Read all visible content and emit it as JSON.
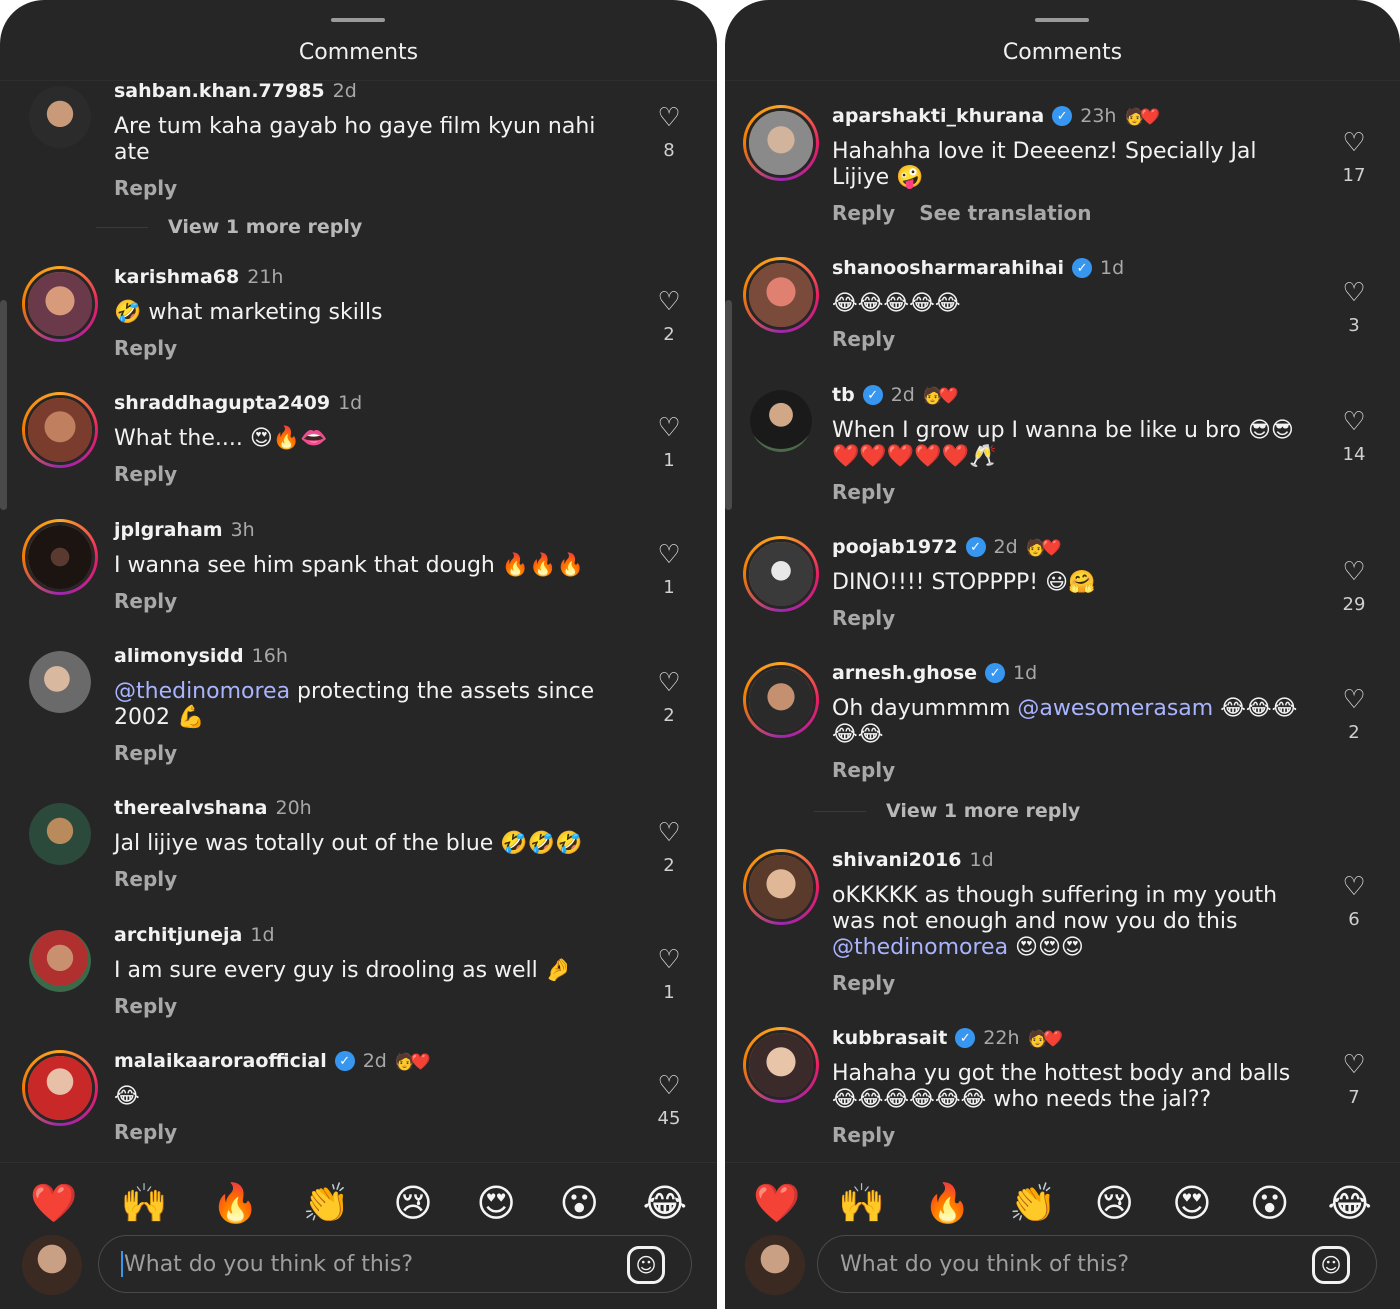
{
  "left": {
    "header_title": "Comments",
    "comments": [
      {
        "username": "sahban.khan.77985",
        "time": "2d",
        "verified": false,
        "creator_liked": false,
        "text_parts": [
          {
            "t": "Are tum kaha gayab ho gaye film kyun nahi ate",
            "m": false
          }
        ],
        "actions": [
          "Reply"
        ],
        "likes": "8",
        "more_replies": "View 1 more reply"
      },
      {
        "username": "karishma68",
        "time": "21h",
        "verified": false,
        "creator_liked": false,
        "text_parts": [
          {
            "t": "🤣 what marketing skills",
            "m": false
          }
        ],
        "actions": [
          "Reply"
        ],
        "likes": "2"
      },
      {
        "username": "shraddhagupta2409",
        "time": "1d",
        "verified": false,
        "creator_liked": false,
        "text_parts": [
          {
            "t": "What the.... 😍🔥👄",
            "m": false
          }
        ],
        "actions": [
          "Reply"
        ],
        "likes": "1"
      },
      {
        "username": "jplgraham",
        "time": "3h",
        "verified": false,
        "creator_liked": false,
        "text_parts": [
          {
            "t": "I wanna see him spank that dough 🔥🔥🔥",
            "m": false
          }
        ],
        "actions": [
          "Reply"
        ],
        "likes": "1"
      },
      {
        "username": "alimonysidd",
        "time": "16h",
        "verified": false,
        "creator_liked": false,
        "text_parts": [
          {
            "t": "@thedinomorea",
            "m": true
          },
          {
            "t": " protecting the assets since 2002 💪",
            "m": false
          }
        ],
        "actions": [
          "Reply"
        ],
        "likes": "2"
      },
      {
        "username": "therealvshana",
        "time": "20h",
        "verified": false,
        "creator_liked": false,
        "text_parts": [
          {
            "t": "Jal lijiye was totally out of the blue 🤣🤣🤣",
            "m": false
          }
        ],
        "actions": [
          "Reply"
        ],
        "likes": "2"
      },
      {
        "username": "architjuneja",
        "time": "1d",
        "verified": false,
        "creator_liked": false,
        "text_parts": [
          {
            "t": "I am sure every guy is drooling as well 🤌",
            "m": false
          }
        ],
        "actions": [
          "Reply"
        ],
        "likes": "1"
      },
      {
        "username": "malaikaaroraofficial",
        "time": "2d",
        "verified": true,
        "creator_liked": true,
        "text_parts": [
          {
            "t": "😂",
            "m": false
          }
        ],
        "actions": [
          "Reply"
        ],
        "likes": "45"
      }
    ],
    "reactions": [
      "❤️",
      "🙌",
      "🔥",
      "👏",
      "😢",
      "😍",
      "😮",
      "😂"
    ],
    "input_placeholder": "What do you think of this?"
  },
  "right": {
    "header_title": "Comments",
    "comments": [
      {
        "username": "aparshakti_khurana",
        "time": "23h",
        "verified": true,
        "creator_liked": true,
        "text_parts": [
          {
            "t": "Hahahha love it Deeeenz! Specially Jal Lijiye 🤪",
            "m": false
          }
        ],
        "actions": [
          "Reply",
          "See translation"
        ],
        "likes": "17"
      },
      {
        "username": "shanoosharmarahihai",
        "time": "1d",
        "verified": true,
        "creator_liked": false,
        "text_parts": [
          {
            "t": "😂😂😂😂😂",
            "m": false
          }
        ],
        "actions": [
          "Reply"
        ],
        "likes": "3"
      },
      {
        "username": "tb",
        "time": "2d",
        "verified": true,
        "creator_liked": true,
        "text_parts": [
          {
            "t": "When I grow up I wanna be like u bro 😎😎 ❤️❤️❤️❤️❤️🥂",
            "m": false
          }
        ],
        "actions": [
          "Reply"
        ],
        "likes": "14"
      },
      {
        "username": "poojab1972",
        "time": "2d",
        "verified": true,
        "creator_liked": true,
        "text_parts": [
          {
            "t": "DINO!!!! STOPPPP! 😃🤗",
            "m": false
          }
        ],
        "actions": [
          "Reply"
        ],
        "likes": "29"
      },
      {
        "username": "arnesh.ghose",
        "time": "1d",
        "verified": true,
        "creator_liked": false,
        "text_parts": [
          {
            "t": "Oh dayummmm ",
            "m": false
          },
          {
            "t": "@awesomerasam",
            "m": true
          },
          {
            "t": " 😂😂😂😂😂",
            "m": false
          }
        ],
        "actions": [
          "Reply"
        ],
        "likes": "2",
        "more_replies": "View 1 more reply"
      },
      {
        "username": "shivani2016",
        "time": "1d",
        "verified": false,
        "creator_liked": false,
        "text_parts": [
          {
            "t": "oKKKKK as though suffering in my youth was not enough and now you do this ",
            "m": false
          },
          {
            "t": "@thedinomorea",
            "m": true
          },
          {
            "t": " 😍😍😍",
            "m": false
          }
        ],
        "actions": [
          "Reply"
        ],
        "likes": "6"
      },
      {
        "username": "kubbrasait",
        "time": "22h",
        "verified": true,
        "creator_liked": true,
        "text_parts": [
          {
            "t": "Hahaha yu got the hottest body and balls 😂😂😂😂😂😂 who needs the jal??",
            "m": false
          }
        ],
        "actions": [
          "Reply"
        ],
        "likes": "7"
      }
    ],
    "reactions": [
      "❤️",
      "🙌",
      "🔥",
      "👏",
      "😢",
      "😍",
      "😮",
      "😂"
    ],
    "input_placeholder": "What do you think of this?"
  },
  "colors": {
    "background": "#262626",
    "mention": "#a9b4ff",
    "verified": "#3797f0",
    "muted_text": "#a8a8a8"
  },
  "icons": {
    "like": "heart-outline-icon",
    "verified": "verified-badge-icon",
    "creator_like": "creator-heart-icon",
    "sticker": "sticker-icon"
  }
}
